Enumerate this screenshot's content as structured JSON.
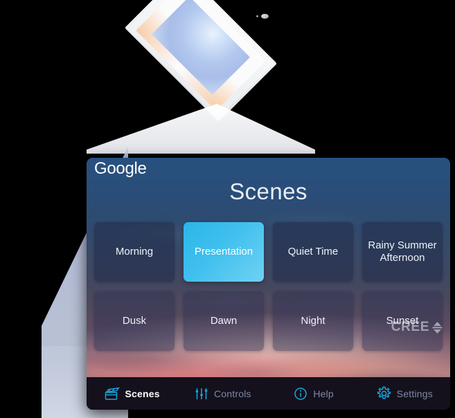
{
  "device": {
    "product_name": "cree-led-ceiling-light-panel",
    "panel_sensor": "occupancy-sensor",
    "light_beam": "downward-light-beam"
  },
  "header": {
    "brand_left": "Google",
    "brand_right": "CREE",
    "brand_right_mark": "cree-updown-arrows-icon"
  },
  "page": {
    "title": "Scenes"
  },
  "scenes": {
    "rows": [
      [
        {
          "label": "Morning",
          "selected": false
        },
        {
          "label": "Presentation",
          "selected": true
        },
        {
          "label": "Quiet Time",
          "selected": false
        },
        {
          "label": "Rainy Summer Afternoon",
          "selected": false
        }
      ],
      [
        {
          "label": "Dusk",
          "selected": false
        },
        {
          "label": "Dawn",
          "selected": false
        },
        {
          "label": "Night",
          "selected": false
        },
        {
          "label": "Sunset",
          "selected": false
        }
      ]
    ]
  },
  "navbar": {
    "items": [
      {
        "label": "Scenes",
        "icon": "clapperboard-icon",
        "active": true
      },
      {
        "label": "Controls",
        "icon": "sliders-icon",
        "active": false
      },
      {
        "label": "Help",
        "icon": "info-circle-icon",
        "active": false
      },
      {
        "label": "Settings",
        "icon": "gear-icon",
        "active": false
      }
    ]
  },
  "colors": {
    "accent_cyan": "#29b6e8",
    "nav_icon_cyan": "#1aa9e0",
    "nav_label_inactive": "#7d89a8",
    "nav_bar_bg": "#14111c",
    "header_blue": "#2e4f78",
    "tile_bg": "rgba(36,46,78,.62)"
  }
}
